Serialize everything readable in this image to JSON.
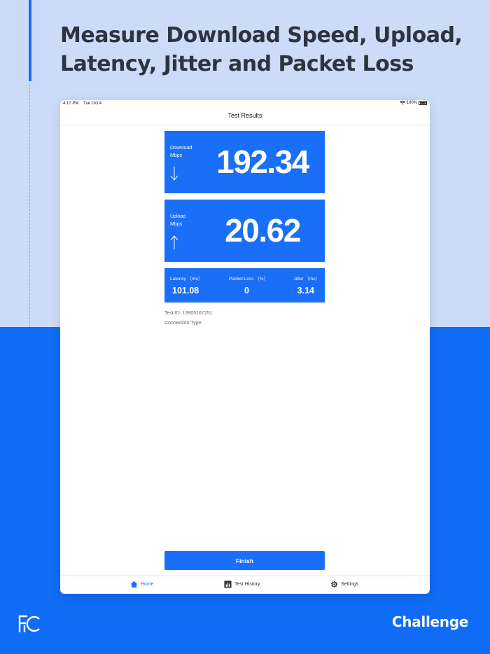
{
  "headline": "Measure Download Speed, Upload, Latency, Jitter and Packet Loss",
  "status_bar": {
    "time": "4:17 PM",
    "date": "Tue Oct 4",
    "battery": "100%"
  },
  "nav": {
    "title": "Test Results"
  },
  "download": {
    "label": "Download",
    "unit": "Mbps",
    "value": "192.34"
  },
  "upload": {
    "label": "Upload",
    "unit": "Mbps",
    "value": "20.62"
  },
  "stats": {
    "latency_label": "Latency （ms）",
    "latency_value": "101.08",
    "packet_loss_label": "Packet Loss （%）",
    "packet_loss_value": "0",
    "jitter_label": "Jitter （ms）",
    "jitter_value": "3.14"
  },
  "info": {
    "test_id": "Test ID: 13905167251",
    "connection_type": "Connection Type:"
  },
  "finish_label": "Finish",
  "tabs": [
    {
      "label": "Home",
      "icon": "home-icon",
      "active": true
    },
    {
      "label": "Test History",
      "icon": "bar-chart-icon",
      "active": false
    },
    {
      "label": "Settings",
      "icon": "gear-icon",
      "active": false
    }
  ],
  "brand": "Challenge",
  "logo": "FC",
  "colors": {
    "accent": "#1a6ff8",
    "background_top": "#ccdbf7",
    "background_bottom": "#106cf5",
    "headline": "#2d3440"
  }
}
